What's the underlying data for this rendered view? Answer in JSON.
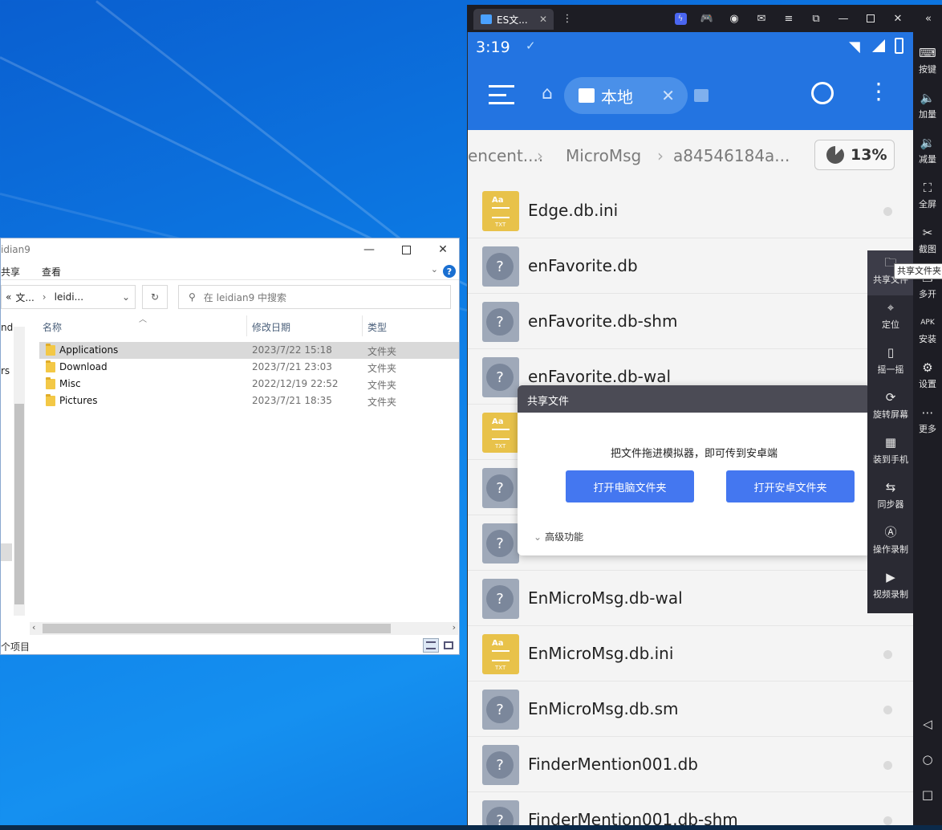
{
  "explorer": {
    "title": "idian9",
    "ribbon": {
      "share": "共享",
      "view": "查看",
      "help": "?"
    },
    "address": {
      "prefix": "«",
      "seg1": "文...",
      "sep": "›",
      "seg2": "leidi...",
      "dropdown": "⌄"
    },
    "search_placeholder": "在 leidian9 中搜索",
    "nav_fragments": [
      "nd",
      "rs"
    ],
    "columns": {
      "name": "名称",
      "modified": "修改日期",
      "type": "类型"
    },
    "files": [
      {
        "name": "Applications",
        "date": "2023/7/22 15:18",
        "type": "文件夹"
      },
      {
        "name": "Download",
        "date": "2023/7/21 23:03",
        "type": "文件夹"
      },
      {
        "name": "Misc",
        "date": "2022/12/19 22:52",
        "type": "文件夹"
      },
      {
        "name": "Pictures",
        "date": "2023/7/21 18:35",
        "type": "文件夹"
      }
    ],
    "status": "个项目"
  },
  "emulator": {
    "tab_title": "ES文...",
    "status": {
      "time": "3:19"
    },
    "appbar": {
      "location_pill": "本地"
    },
    "breadcrumbs": [
      "encent....",
      "MicroMsg",
      "a84546184a..."
    ],
    "storage_percent": "13%",
    "files": [
      {
        "name": "Edge.db.ini",
        "kind": "txt"
      },
      {
        "name": "enFavorite.db",
        "kind": "unknown"
      },
      {
        "name": "enFavorite.db-shm",
        "kind": "unknown"
      },
      {
        "name": "enFavorite.db-wal",
        "kind": "unknown"
      },
      {
        "name": "",
        "kind": "txt"
      },
      {
        "name": "",
        "kind": "unknown"
      },
      {
        "name": "",
        "kind": "unknown"
      },
      {
        "name": "EnMicroMsg.db-wal",
        "kind": "unknown"
      },
      {
        "name": "EnMicroMsg.db.ini",
        "kind": "txt"
      },
      {
        "name": "EnMicroMsg.db.sm",
        "kind": "unknown"
      },
      {
        "name": "FinderMention001.db",
        "kind": "unknown"
      },
      {
        "name": "FinderMention001.db-shm",
        "kind": "unknown"
      }
    ],
    "share_dialog": {
      "title": "共享文件",
      "message": "把文件拖进模拟器，即可传到安卓端",
      "open_pc_folder": "打开电脑文件夹",
      "open_android_folder": "打开安卓文件夹",
      "advanced": "高级功能"
    },
    "sidebar": [
      {
        "label": "按键",
        "icon": "keyboard-icon"
      },
      {
        "label": "加量",
        "icon": "volume-up-icon"
      },
      {
        "label": "减量",
        "icon": "volume-down-icon"
      },
      {
        "label": "全屏",
        "icon": "fullscreen-icon"
      },
      {
        "label": "截图",
        "icon": "scissors-icon"
      },
      {
        "label": "多开",
        "icon": "multi-instance-icon"
      },
      {
        "label": "安装",
        "icon": "apk-icon"
      },
      {
        "label": "设置",
        "icon": "gear-icon"
      },
      {
        "label": "更多",
        "icon": "more-icon"
      }
    ],
    "sub_panel": [
      {
        "label": "共享文件",
        "icon": "folder-icon"
      },
      {
        "label": "定位",
        "icon": "location-icon"
      },
      {
        "label": "摇一摇",
        "icon": "shake-icon"
      },
      {
        "label": "旋转屏幕",
        "icon": "rotate-icon"
      },
      {
        "label": "装到手机",
        "icon": "qr-code-icon"
      },
      {
        "label": "同步器",
        "icon": "sync-icon"
      },
      {
        "label": "操作录制",
        "icon": "record-icon"
      },
      {
        "label": "视频录制",
        "icon": "video-icon"
      }
    ],
    "tooltip": "共享文件夹"
  }
}
